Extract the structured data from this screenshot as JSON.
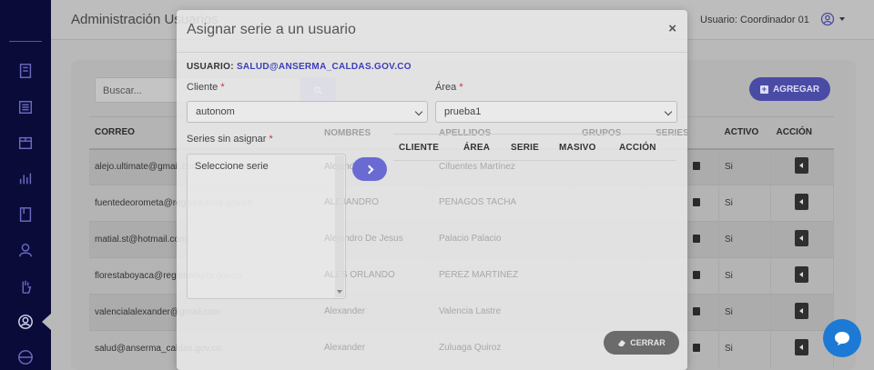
{
  "header": {
    "title": "Administración Usuarios",
    "user_label": "Usuario: Coordinador 01"
  },
  "toolbar": {
    "search_placeholder": "Buscar...",
    "add_label": "AGREGAR"
  },
  "table": {
    "columns": [
      "CORREO",
      "NOMBRES",
      "APELLIDOS",
      "GRUPOS",
      "SERIES",
      "ACTIVO",
      "ACCIÓN"
    ],
    "rows": [
      {
        "correo": "alejo.ultimate@gmail.com",
        "nombres": "Alejandro",
        "apellidos": "Cifuentes Martínez",
        "activo": "Si"
      },
      {
        "correo": "fuentedeorometa@registraduria.gov.co",
        "nombres": "ALEJANDRO",
        "apellidos": "PENAGOS TACHA",
        "activo": "Si"
      },
      {
        "correo": "matial.st@hotmail.com",
        "nombres": "Alejandro De Jesus",
        "apellidos": "Palacio Palacio",
        "activo": "Si"
      },
      {
        "correo": "florestaboyaca@registraduria.gov.co",
        "nombres": "ALES ORLANDO",
        "apellidos": "PEREZ MARTINEZ",
        "activo": "Si"
      },
      {
        "correo": "valencialalexander@gmail.com",
        "nombres": "Alexander",
        "apellidos": "Valencia Lastre",
        "activo": "Si"
      },
      {
        "correo": "salud@anserma_caldas.gov.co",
        "nombres": "Alexander",
        "apellidos": "Zuluaga Quiroz",
        "activo": "Si"
      }
    ]
  },
  "modal": {
    "title": "Asignar serie a un usuario",
    "close_symbol": "×",
    "usuario_label": "USUARIO:",
    "usuario_email": "SALUD@ANSERMA_CALDAS.GOV.CO",
    "cliente_label": "Cliente",
    "cliente_value": "autonom",
    "area_label": "Área",
    "area_value": "prueba1",
    "series_label": "Series sin asignar",
    "series_option": "Seleccione serie",
    "required_mark": "*",
    "assigned_columns": [
      "CLIENTE",
      "ÁREA",
      "SERIE",
      "MASIVO",
      "ACCIÓN"
    ],
    "close_button": "CERRAR"
  },
  "colors": {
    "sidebar": "#0b0b3a",
    "accent": "#4a4ba5",
    "chat": "#1c7ad6"
  }
}
